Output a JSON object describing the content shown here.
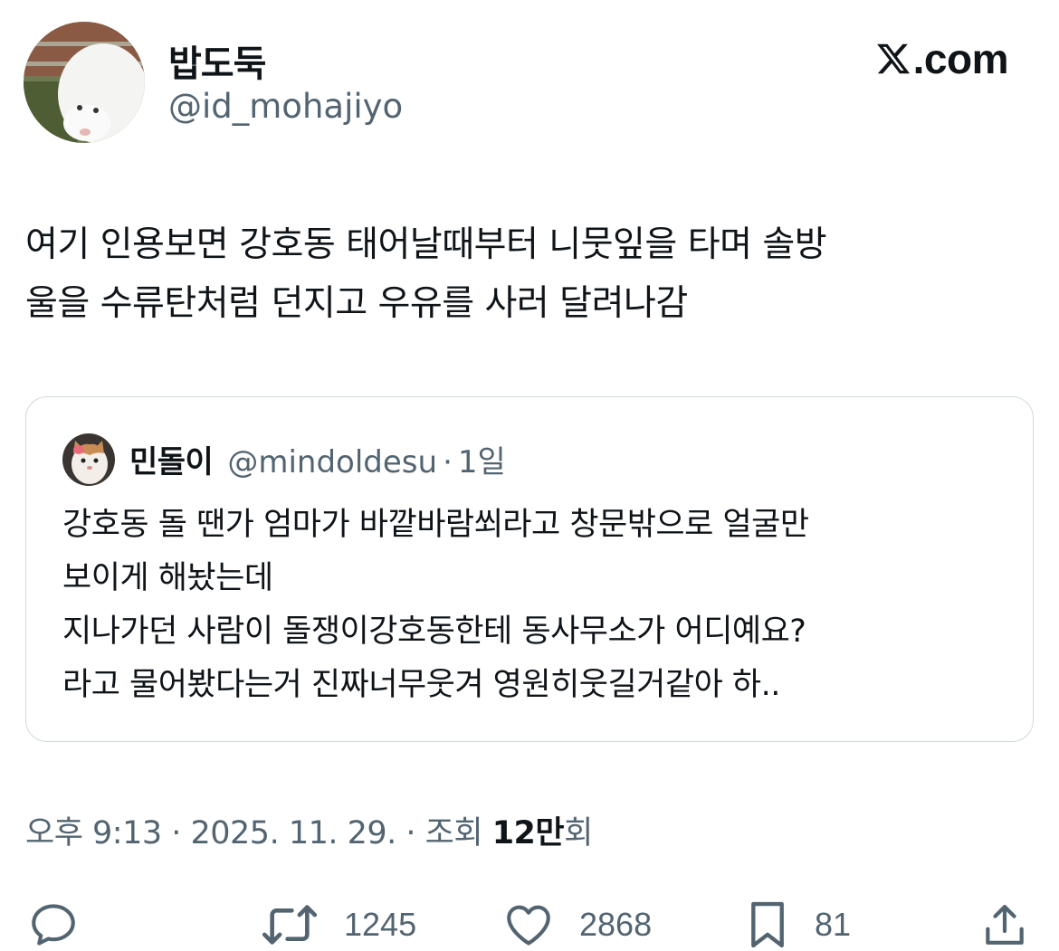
{
  "author": {
    "display_name": "밥도둑",
    "handle": "@id_mohajiyo",
    "avatar_icon": "white-puppy-avatar"
  },
  "brand": {
    "logo_text": ".com",
    "logo_icon": "x-logo-icon"
  },
  "tweet": {
    "lines": [
      "여기 인용보면 강호동 태어날때부터 니뭇잎을 타며 솔방",
      "울을 수류탄처럼 던지고 우유를 사러 달려나감"
    ]
  },
  "quote": {
    "display_name": "민돌이",
    "handle": "@mindoldesu",
    "separator": "·",
    "time": "1일",
    "avatar_icon": "cat-avatar",
    "lines": [
      "강호동 돌 땐가 엄마가 바깥바람쐬라고 창문밖으로 얼굴만",
      "보이게 해놨는데",
      "지나가던 사람이 돌쟁이강호동한테 동사무소가 어디예요?",
      "라고 물어봤다는거 진짜너무웃겨 영원히웃길거같아  하.."
    ]
  },
  "meta": {
    "time_text": "오후 9:13 · 2025. 11. 29. · 조회 ",
    "views_count": "12만",
    "views_suffix": "회"
  },
  "actions": {
    "reply": {
      "icon": "reply-icon"
    },
    "retweet": {
      "icon": "retweet-icon",
      "count": "1245"
    },
    "like": {
      "icon": "heart-icon",
      "count": "2868"
    },
    "bookmark": {
      "icon": "bookmark-icon",
      "count": "81"
    },
    "share": {
      "icon": "share-icon"
    }
  },
  "colors": {
    "text": "#0f1419",
    "secondary": "#536471",
    "border": "#cfd9de"
  }
}
